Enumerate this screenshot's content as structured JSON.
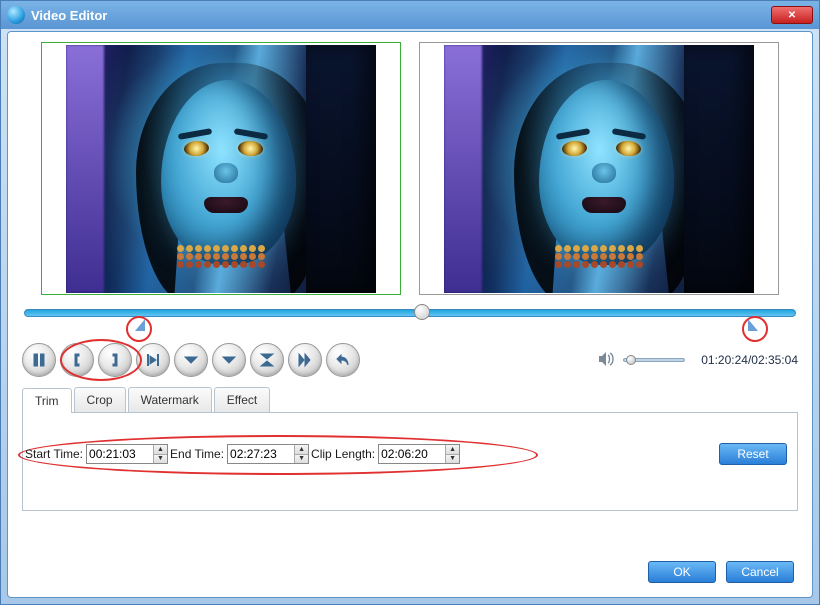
{
  "window": {
    "title": "Video Editor"
  },
  "playback": {
    "position_label": "01:20:24/02:35:04"
  },
  "tabs": {
    "items": [
      "Trim",
      "Crop",
      "Watermark",
      "Effect"
    ],
    "active": "Trim"
  },
  "trim": {
    "start_label": "Start Time:",
    "start_value": "00:21:03",
    "end_label": "End Time:",
    "end_value": "02:27:23",
    "length_label": "Clip Length:",
    "length_value": "02:06:20",
    "reset_label": "Reset"
  },
  "footer": {
    "ok": "OK",
    "cancel": "Cancel"
  },
  "control_icons": {
    "pause": "pause-icon",
    "set_start": "bracket-open-icon",
    "set_end": "bracket-close-icon",
    "play_range": "play-range-icon",
    "prev_frame": "step-back-icon",
    "next_frame": "step-forward-icon",
    "snapshot": "frame-icon",
    "skip": "skip-icon",
    "undo": "undo-icon"
  }
}
